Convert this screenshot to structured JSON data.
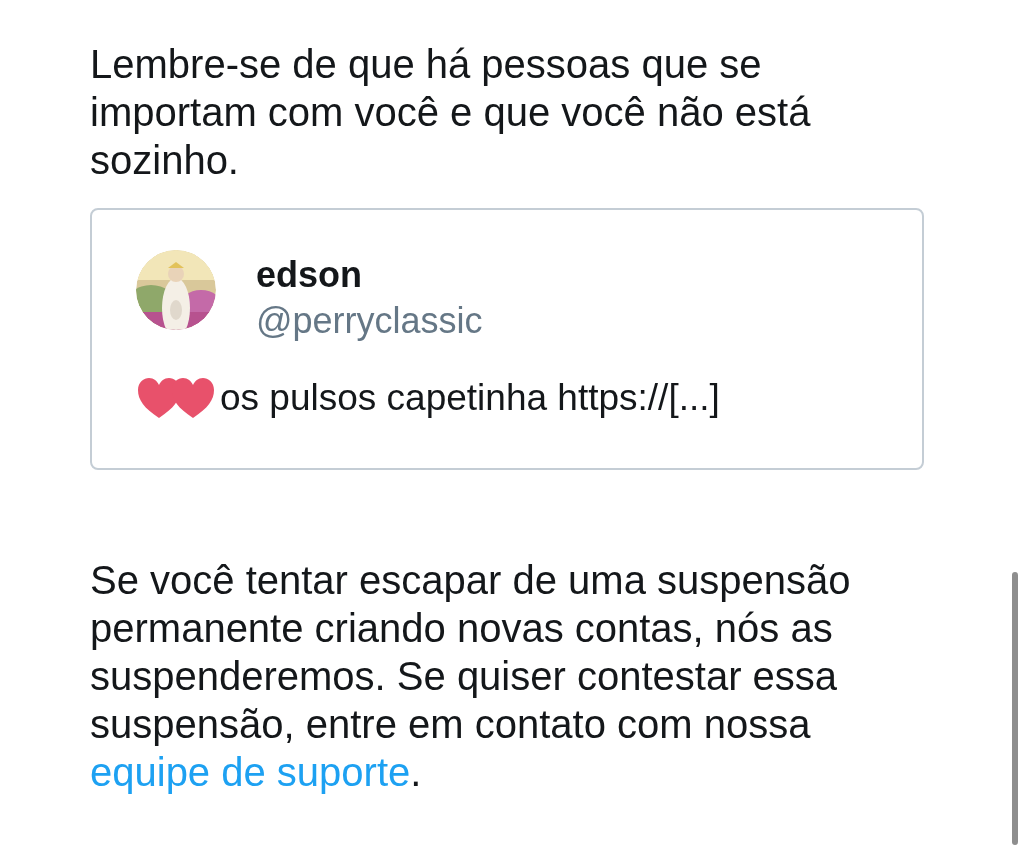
{
  "intro": "Lembre-se de que há pessoas que se importam com você e que você não está sozinho.",
  "tweet": {
    "name": "edson",
    "handle": "@perryclassic",
    "text": "os pulsos capetinha https://[...]",
    "stickers": [
      {
        "kind": "heart"
      },
      {
        "kind": "heart"
      }
    ]
  },
  "notice": {
    "text": "Se você tentar escapar de uma suspensão permanente criando novas contas, nós as suspenderemos. Se quiser contestar essa suspensão, entre em contato com nossa ",
    "link": "equipe de suporte",
    "after": "."
  }
}
